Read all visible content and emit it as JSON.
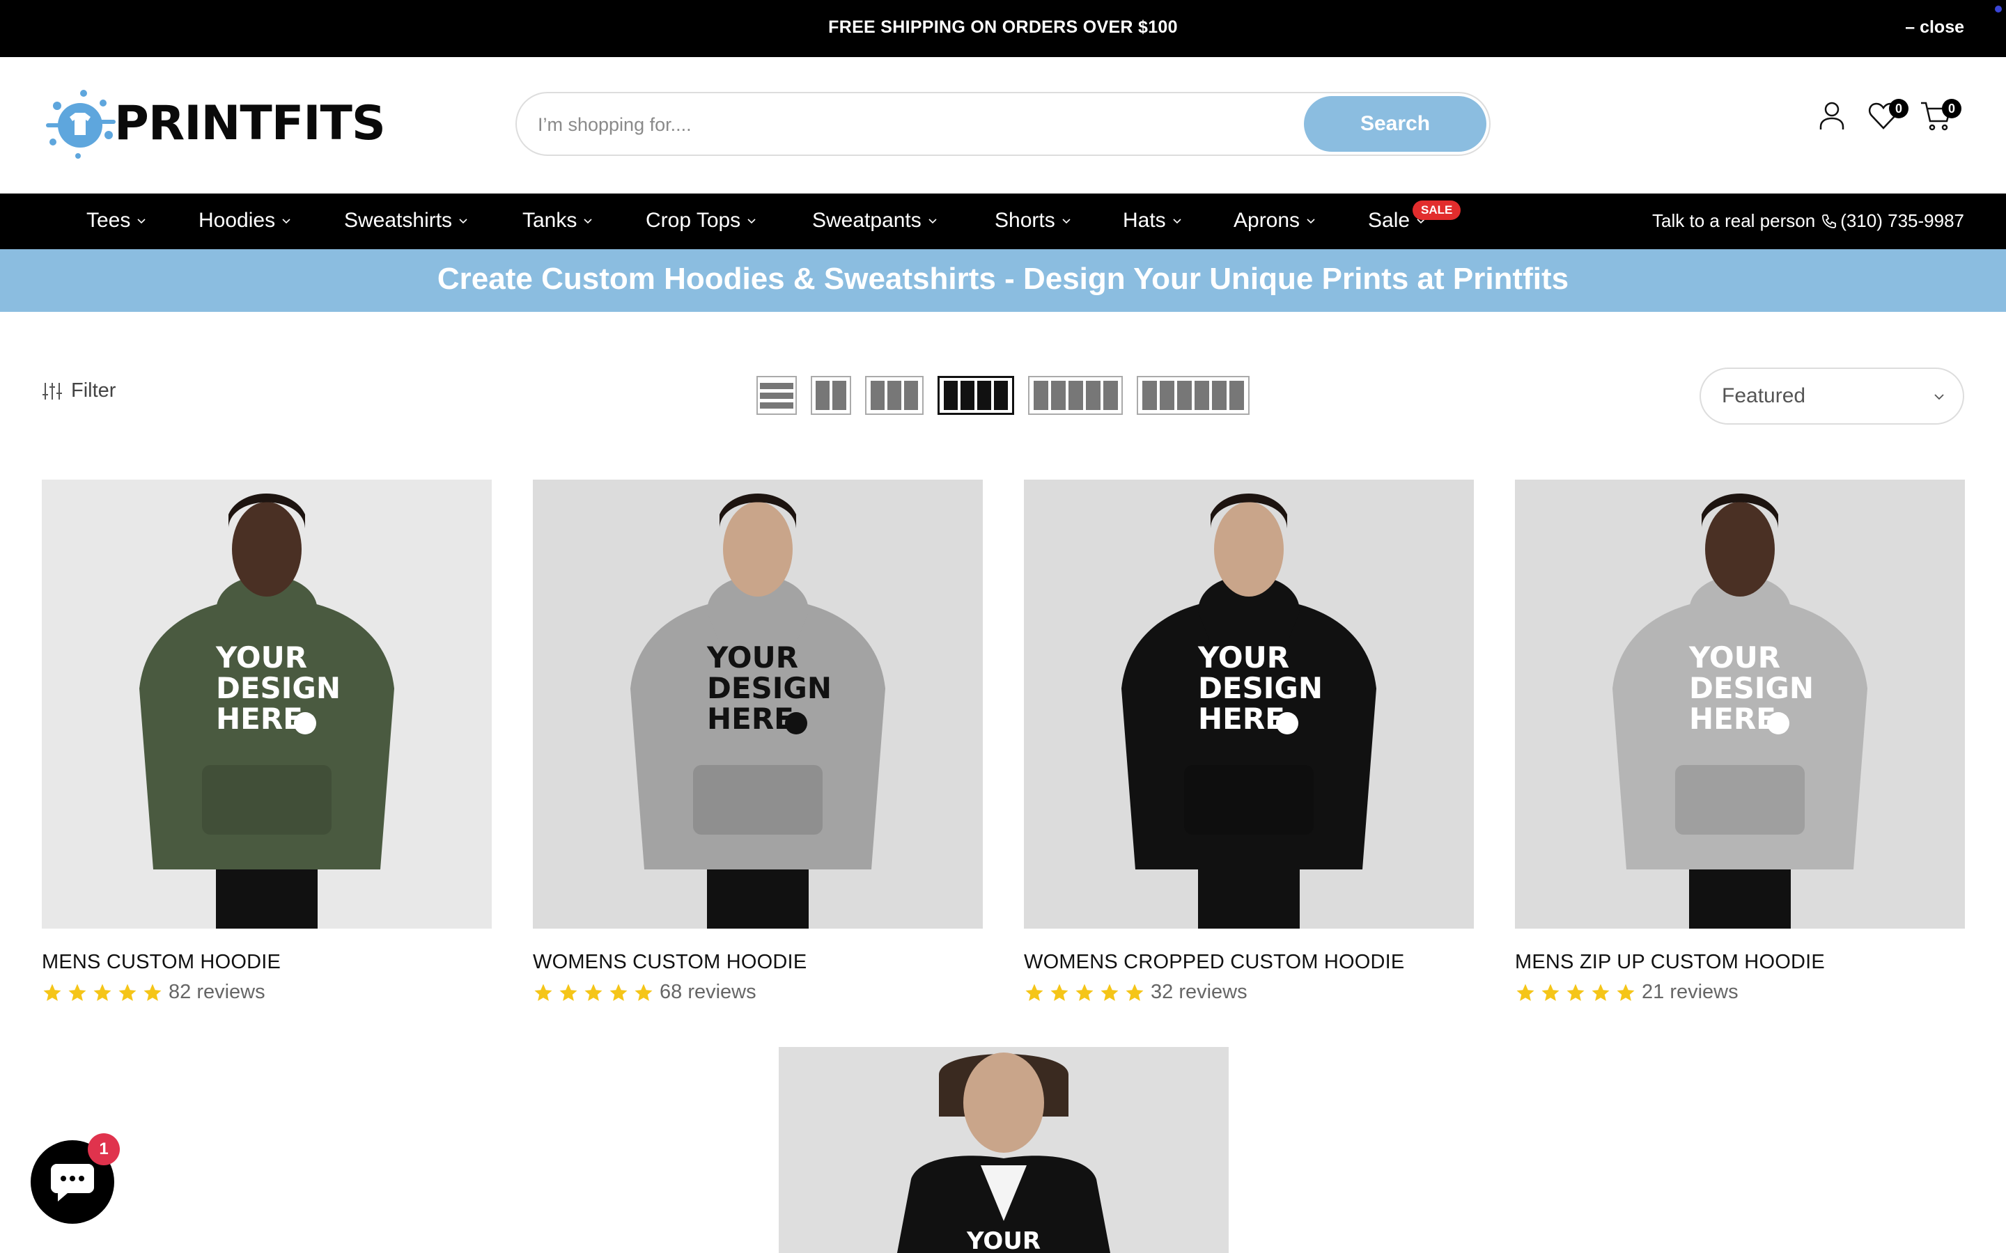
{
  "announcement": {
    "message": "FREE SHIPPING ON ORDERS OVER $100",
    "close_label": "– close"
  },
  "header": {
    "logo_text": "PRINTFITS",
    "search_placeholder": "I’m shopping for....",
    "search_button": "Search",
    "wishlist_count": "0",
    "cart_count": "0"
  },
  "nav": {
    "items": [
      {
        "label": "Tees"
      },
      {
        "label": "Hoodies"
      },
      {
        "label": "Sweatshirts"
      },
      {
        "label": "Tanks"
      },
      {
        "label": "Crop Tops"
      },
      {
        "label": "Sweatpants"
      },
      {
        "label": "Shorts"
      },
      {
        "label": "Hats"
      },
      {
        "label": "Aprons"
      },
      {
        "label": "Sale"
      }
    ],
    "sale_badge": "SALE",
    "phone_prefix": "Talk to a real person",
    "phone_number": "(310) 735-9987"
  },
  "banner": {
    "title": "Create Custom Hoodies & Sweatshirts - Design Your Unique Prints at Printfits"
  },
  "toolbar": {
    "filter_label": "Filter",
    "sort_selected": "Featured"
  },
  "products": [
    {
      "title": "MENS CUSTOM HOODIE",
      "reviews": "82 reviews",
      "rating": 5,
      "hoodie_color": "#4a5a40",
      "print_color": "#ffffff"
    },
    {
      "title": "WOMENS CUSTOM HOODIE",
      "reviews": "68 reviews",
      "rating": 5,
      "hoodie_color": "#a3a3a3",
      "print_color": "#111111"
    },
    {
      "title": "WOMENS CROPPED CUSTOM HOODIE",
      "reviews": "32 reviews",
      "rating": 5,
      "hoodie_color": "#111111",
      "print_color": "#ffffff"
    },
    {
      "title": "MENS ZIP UP CUSTOM HOODIE",
      "reviews": "21 reviews",
      "rating": 5,
      "hoodie_color": "#b5b5b5",
      "print_color": "#ffffff"
    }
  ],
  "product_print_text": [
    "YOUR",
    "DESIGN",
    "HERE"
  ],
  "partial_product": {
    "print_text": "YOUR",
    "hoodie_color": "#111111"
  },
  "chat": {
    "unread_count": "1"
  },
  "colors": {
    "accent": "#8bbde0",
    "star": "#f5c518",
    "sale": "#e22d2d"
  }
}
